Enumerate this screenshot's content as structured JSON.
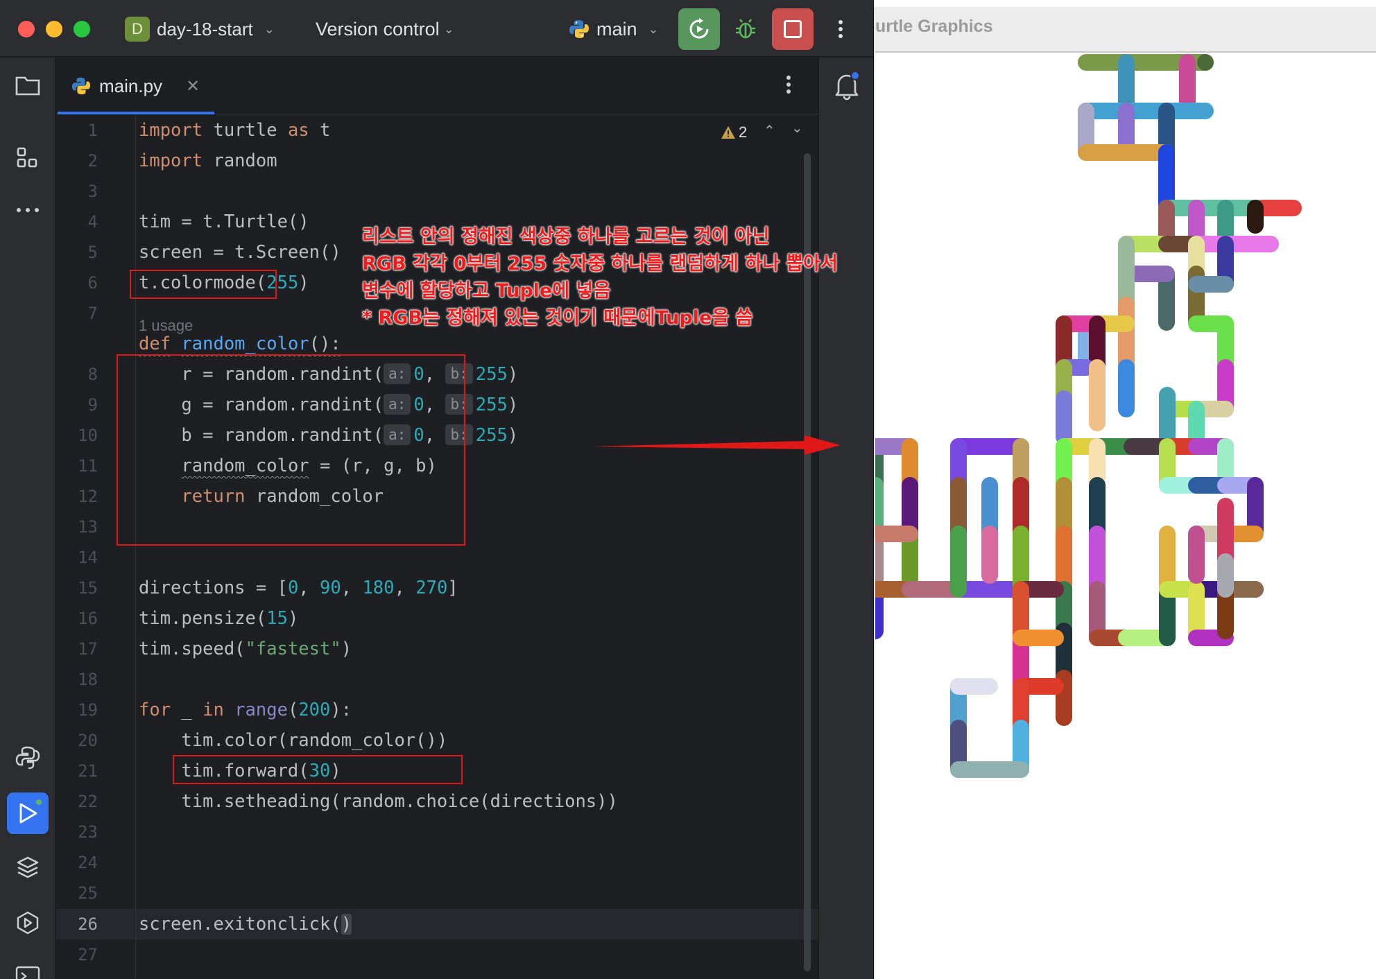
{
  "ide": {
    "project": {
      "badge": "D",
      "name": "day-18-start"
    },
    "version_control": "Version control",
    "branch": "main",
    "tab": {
      "label": "main.py"
    },
    "warning_count": "2",
    "usage_hint": "1 usage",
    "line_numbers": [
      "1",
      "2",
      "3",
      "4",
      "5",
      "6",
      "7",
      "8",
      "9",
      "10",
      "11",
      "12",
      "13",
      "14",
      "15",
      "16",
      "17",
      "18",
      "19",
      "20",
      "21",
      "22",
      "23",
      "24",
      "25",
      "26",
      "27"
    ],
    "code": {
      "l1": {
        "kw1": "import",
        "t1": " turtle ",
        "kw2": "as",
        "t2": " t"
      },
      "l2": {
        "kw1": "import",
        "t1": " random"
      },
      "l4": {
        "t1": "tim = t.Turtle()"
      },
      "l5": {
        "t1": "screen = t.Screen()"
      },
      "l6": {
        "t1": "t.colormode(",
        "n1": "255",
        "t2": ")"
      },
      "l8": {
        "kw1": "def",
        "sp": " ",
        "fn": "random_color",
        "t1": "():"
      },
      "l9": {
        "t1": "    r = random.randint(",
        "h1": "a:",
        "n1": "0",
        "t2": ", ",
        "h2": "b:",
        "n2": "255",
        "t3": ")"
      },
      "l10": {
        "t1": "    g = random.randint(",
        "h1": "a:",
        "n1": "0",
        "t2": ", ",
        "h2": "b:",
        "n2": "255",
        "t3": ")"
      },
      "l11": {
        "t1": "    b = random.randint(",
        "h1": "a:",
        "n1": "0",
        "t2": ", ",
        "h2": "b:",
        "n2": "255",
        "t3": ")"
      },
      "l12": {
        "t0": "    ",
        "var": "random_color",
        "t1": " = (r, g, b)"
      },
      "l13": {
        "t0": "    ",
        "kw1": "return",
        "t1": " random_color"
      },
      "l16": {
        "t1": "directions = [",
        "n1": "0",
        "c1": ", ",
        "n2": "90",
        "c2": ", ",
        "n3": "180",
        "c3": ", ",
        "n4": "270",
        "t2": "]"
      },
      "l17": {
        "t1": "tim.pensize(",
        "n1": "15",
        "t2": ")"
      },
      "l18": {
        "t1": "tim.speed(",
        "s1": "\"fastest\"",
        "t2": ")"
      },
      "l20": {
        "kw1": "for",
        "t1": " _ ",
        "kw2": "in",
        "sp": " ",
        "bi": "range",
        "t2": "(",
        "n1": "200",
        "t3": "):"
      },
      "l21": {
        "t1": "    tim.color(random_color())"
      },
      "l22": {
        "t1": "    tim.forward(",
        "n1": "30",
        "t2": ")"
      },
      "l23": {
        "t1": "    tim.setheading(random.choice(directions))"
      },
      "l26": {
        "t1": "screen.exitonclick(",
        "t2": ")"
      }
    },
    "annotation": [
      "리스트 안의 정해진 색상중 하나를 고르는 것이 아닌",
      "RGB 각각 0부터 255 숫자중 하나를 랜덤하게 하나 뽑아서",
      "변수에 할당하고 Tuple에 넣음",
      "* RGB는 정해져 있는 것이기 때문에Tuple을 씀"
    ]
  },
  "turtle_window": {
    "title": "urtle Graphics"
  }
}
